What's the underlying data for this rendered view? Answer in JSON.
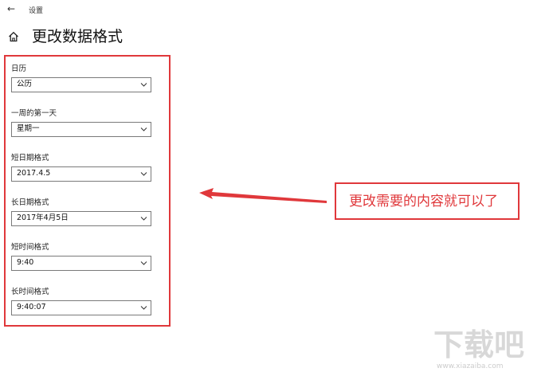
{
  "window": {
    "app_title": "设置",
    "back_icon": "arrow-left-icon"
  },
  "header": {
    "home_icon": "home-icon",
    "title": "更改数据格式"
  },
  "settings": [
    {
      "label": "日历",
      "value": "公历"
    },
    {
      "label": "一周的第一天",
      "value": "星期一"
    },
    {
      "label": "短日期格式",
      "value": "2017.4.5"
    },
    {
      "label": "长日期格式",
      "value": "2017年4月5日"
    },
    {
      "label": "短时间格式",
      "value": "9:40"
    },
    {
      "label": "长时间格式",
      "value": "9:40:07"
    }
  ],
  "annotation": {
    "text": "更改需要的内容就可以了",
    "color": "#e0383b"
  },
  "watermark": {
    "logo_text": "下载吧",
    "url": "www.xiazaiba.com"
  }
}
